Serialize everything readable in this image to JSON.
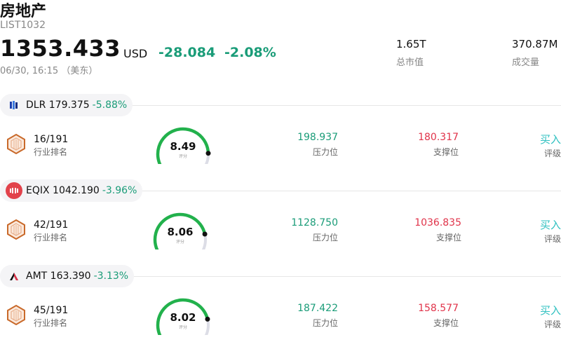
{
  "header": {
    "title": "房地产",
    "code": "LIST1032",
    "price": "1353.433",
    "currency": "USD",
    "change": "-28.084",
    "change_pct": "-2.08%",
    "time": "06/30, 16:15 （美东）",
    "market_cap": {
      "value": "1.65T",
      "label": "总市值"
    },
    "volume": {
      "value": "370.87M",
      "label": "成交量"
    }
  },
  "colors": {
    "down": "#1a9c78",
    "resistance": "#1a9c78",
    "support": "#e0334a",
    "gauge": "#22b14c",
    "rating": "#2ec0c0"
  },
  "stocks": [
    {
      "ticker_line": "DLR 179.375",
      "pct": "-5.88%",
      "logo_icon": "dlr-logo-icon",
      "rank": "16/191",
      "rank_label": "行业排名",
      "score": 8.49,
      "score_text": "8.49",
      "score_label": "评分",
      "resistance": "198.937",
      "resistance_label": "压力位",
      "support": "180.317",
      "support_label": "支撑位",
      "rating": "买入",
      "rating_label": "评级"
    },
    {
      "ticker_line": "EQIX 1042.190",
      "pct": "-3.96%",
      "logo_icon": "eqix-logo-icon",
      "rank": "42/191",
      "rank_label": "行业排名",
      "score": 8.06,
      "score_text": "8.06",
      "score_label": "评分",
      "resistance": "1128.750",
      "resistance_label": "压力位",
      "support": "1036.835",
      "support_label": "支撑位",
      "rating": "买入",
      "rating_label": "评级"
    },
    {
      "ticker_line": "AMT 163.390",
      "pct": "-3.13%",
      "logo_icon": "amt-logo-icon",
      "rank": "45/191",
      "rank_label": "行业排名",
      "score": 8.02,
      "score_text": "8.02",
      "score_label": "评分",
      "resistance": "187.422",
      "resistance_label": "压力位",
      "support": "158.577",
      "support_label": "支撑位",
      "rating": "买入",
      "rating_label": "评级"
    }
  ]
}
